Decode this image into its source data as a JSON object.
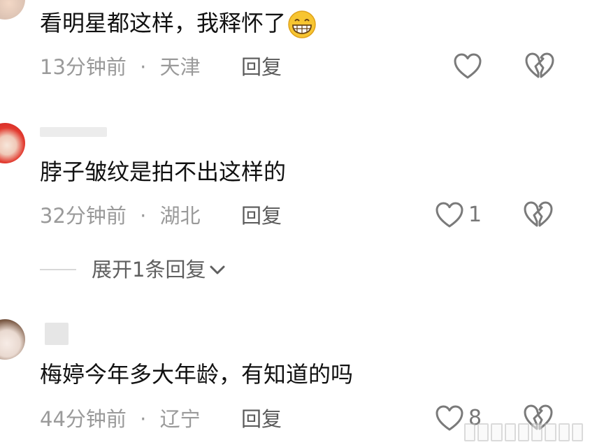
{
  "comments": [
    {
      "text": "看明星都这样，我释怀了",
      "emoji": "grinning-face-emoji",
      "time": "13分钟前",
      "separator": "·",
      "location": "天津",
      "reply_label": "回复",
      "like_count": ""
    },
    {
      "text": "脖子皱纹是拍不出这样的",
      "time": "32分钟前",
      "separator": "·",
      "location": "湖北",
      "reply_label": "回复",
      "like_count": "1",
      "expand_label": "展开1条回复"
    },
    {
      "text": "梅婷今年多大年龄，有知道的吗",
      "time": "44分钟前",
      "separator": "·",
      "location": "辽宁",
      "reply_label": "回复",
      "like_count": "8"
    }
  ],
  "icons": {
    "like": "heart-outline-icon",
    "dislike": "broken-heart-icon",
    "expand_chevron": "chevron-down-icon"
  },
  "colors": {
    "text_primary": "#111111",
    "text_secondary": "#9a9a9a",
    "reply": "#5a5a5a",
    "icon_stroke": "#7a7a7a",
    "emoji_fill": "#f7c531"
  }
}
